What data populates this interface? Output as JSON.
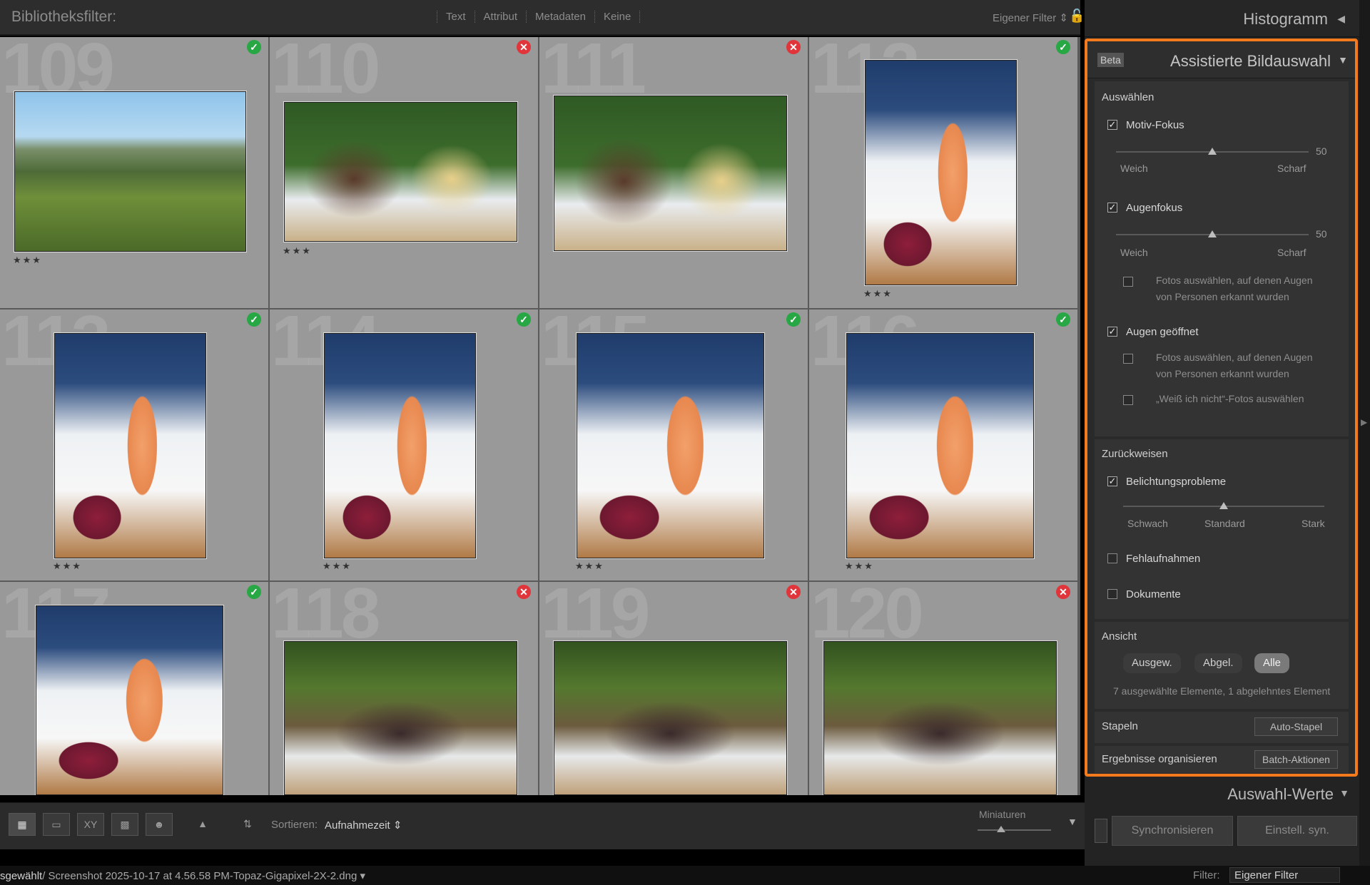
{
  "filter_bar": {
    "title": "Bibliotheksfilter:",
    "modes": [
      "Text",
      "Attribut",
      "Metadaten",
      "Keine"
    ],
    "custom_filter": "Eigener Filter ⇕",
    "lock_icon": "lock-icon"
  },
  "grid": {
    "cells": [
      {
        "number": "109",
        "flag": "pick",
        "flag_glyph": "✓",
        "stars": "★★★",
        "photo": "vineyard-couple"
      },
      {
        "number": "110",
        "flag": "reject",
        "flag_glyph": "✕",
        "stars": "★★★",
        "photo": "dinner-toast"
      },
      {
        "number": "111",
        "flag": "reject",
        "flag_glyph": "✕",
        "stars": "",
        "photo": "dinner-group"
      },
      {
        "number": "112",
        "flag": "pick",
        "flag_glyph": "✓",
        "stars": "★★★",
        "photo": "rose-bottle"
      },
      {
        "number": "113",
        "flag": "pick",
        "flag_glyph": "✓",
        "stars": "★★★",
        "photo": "rose-bottle"
      },
      {
        "number": "114",
        "flag": "pick",
        "flag_glyph": "✓",
        "stars": "★★★",
        "photo": "rose-bottle"
      },
      {
        "number": "115",
        "flag": "pick",
        "flag_glyph": "✓",
        "stars": "★★★",
        "photo": "rose-bottle-garden"
      },
      {
        "number": "116",
        "flag": "pick",
        "flag_glyph": "✓",
        "stars": "★★★",
        "photo": "rose-bottle-garden"
      },
      {
        "number": "117",
        "flag": "pick",
        "flag_glyph": "✓",
        "stars": "",
        "photo": "rose-bottle-garden"
      },
      {
        "number": "118",
        "flag": "reject",
        "flag_glyph": "✕",
        "stars": "",
        "photo": "group-table"
      },
      {
        "number": "119",
        "flag": "reject",
        "flag_glyph": "✕",
        "stars": "",
        "photo": "group-table"
      },
      {
        "number": "120",
        "flag": "reject",
        "flag_glyph": "✕",
        "stars": "",
        "photo": "group-table"
      }
    ]
  },
  "toolbar": {
    "sort_label": "Sortieren:",
    "sort_value": "Aufnahmezeit ⇕",
    "thumbnails_label": "Miniaturen",
    "thumbnail_size": 0.32,
    "view_icons": [
      "grid-view-icon",
      "loupe-view-icon",
      "compare-view-icon",
      "survey-view-icon",
      "people-view-icon",
      "spray-can-icon",
      "sort-az-icon"
    ],
    "xy_label": "XY"
  },
  "status_bar": {
    "path_prefix": "sgewählt",
    "path": "/ Screenshot 2025-10-17 at 4.56.58 PM-Topaz-Gigapixel-2X-2.dng",
    "filter_label": "Filter:",
    "filter_value": "Eigener Filter"
  },
  "right_panel": {
    "histogram_title": "Histogramm",
    "assist": {
      "beta_badge": "Beta",
      "title": "Assistierte Bildauswahl",
      "select_section": {
        "title": "Auswählen",
        "subject_focus": {
          "label": "Motiv-Fokus",
          "checked": true,
          "value": "50",
          "value_num": 50,
          "min_label": "Weich",
          "max_label": "Scharf"
        },
        "eye_focus": {
          "label": "Augenfokus",
          "checked": true,
          "value": "50",
          "value_num": 50,
          "min_label": "Weich",
          "max_label": "Scharf",
          "option_line1": "Fotos auswählen, auf denen Augen",
          "option_line2": "von Personen erkannt wurden"
        },
        "eyes_open": {
          "label": "Augen geöffnet",
          "checked": true,
          "option_line1": "Fotos auswählen, auf denen Augen",
          "option_line2": "von Personen erkannt wurden",
          "dont_know": "„Weiß ich nicht“-Fotos auswählen"
        }
      },
      "reject_section": {
        "title": "Zurückweisen",
        "exposure": {
          "label": "Belichtungsprobleme",
          "checked": true,
          "level": 0.5,
          "labels": [
            "Schwach",
            "Standard",
            "Stark"
          ]
        },
        "misfires": {
          "label": "Fehlaufnahmen",
          "checked": false
        },
        "documents": {
          "label": "Dokumente",
          "checked": false
        }
      },
      "view_section": {
        "title": "Ansicht",
        "buttons": [
          "Ausgew.",
          "Abgel.",
          "Alle"
        ],
        "summary": "7 ausgewählte Elemente, 1 abgelehntes Element"
      },
      "stack_row": {
        "label": "Stapeln",
        "button": "Auto-Stapel"
      },
      "organize_row": {
        "label": "Ergebnisse organisieren",
        "button": "Batch-Aktionen"
      }
    },
    "selection_values_title": "Auswahl-Werte",
    "sync_button": "Synchronisieren",
    "sync_settings_button": "Einstell. syn."
  },
  "colors": {
    "accent_orange": "#f37b1d",
    "pick_green": "#28a745",
    "reject_red": "#e0353a"
  }
}
